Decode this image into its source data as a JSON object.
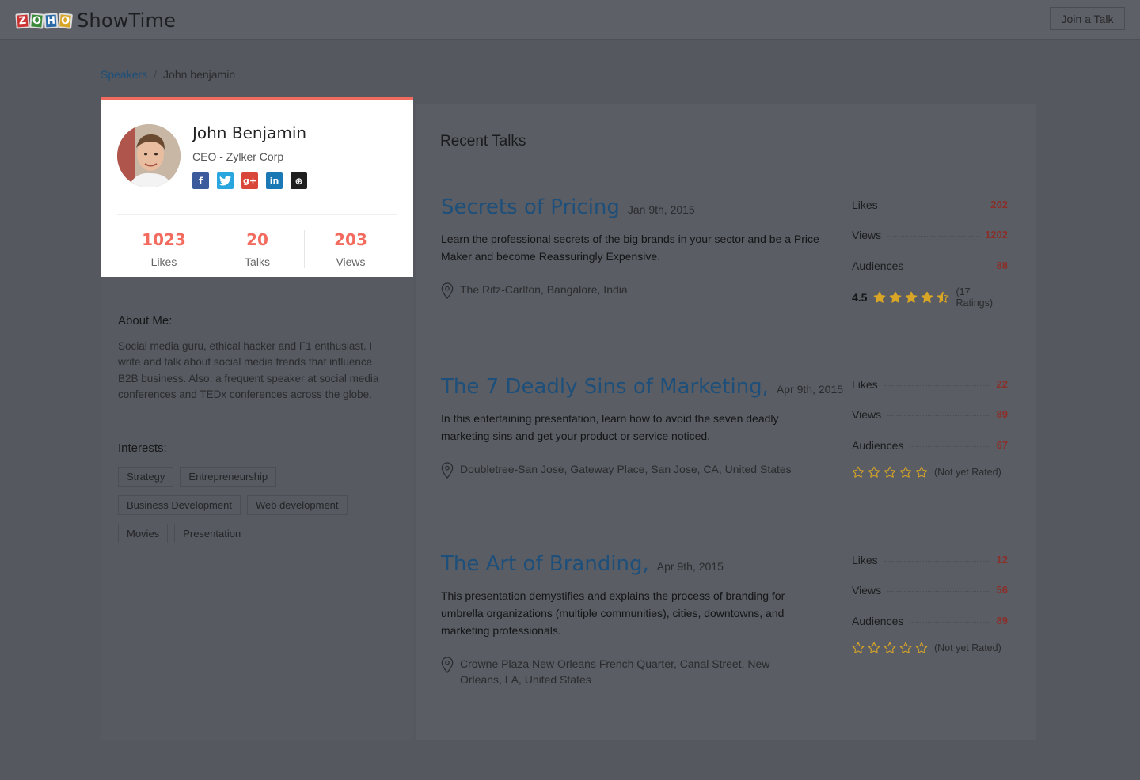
{
  "app": {
    "logo_letters": [
      "Z",
      "O",
      "H",
      "O"
    ],
    "logo_text": "ShowTime",
    "join_button": "Join a Talk"
  },
  "breadcrumb": {
    "parent": "Speakers",
    "separator": "/",
    "current": "John benjamin"
  },
  "profile": {
    "name": "John Benjamin",
    "title": "CEO - Zylker Corp",
    "socials": [
      {
        "icon": "facebook-icon",
        "glyph": "f"
      },
      {
        "icon": "twitter-icon",
        "glyph": "t"
      },
      {
        "icon": "google-plus-icon",
        "glyph": "g+"
      },
      {
        "icon": "linkedin-icon",
        "glyph": "in"
      },
      {
        "icon": "website-icon",
        "glyph": "⊕"
      }
    ],
    "stats": [
      {
        "value": "1023",
        "label": "Likes"
      },
      {
        "value": "20",
        "label": "Talks"
      },
      {
        "value": "203",
        "label": "Views"
      }
    ]
  },
  "about": {
    "heading": "About Me:",
    "text": "Social media guru, ethical hacker and F1 enthusiast. I write and talk about social media trends that influence B2B business. Also, a frequent speaker at social media conferences and TEDx conferences across the globe."
  },
  "interests": {
    "heading": "Interests:",
    "tags": [
      "Strategy",
      "Entrepreneurship",
      "Business Development",
      "Web development",
      "Movies",
      "Presentation"
    ]
  },
  "recent_talks": {
    "heading": "Recent Talks",
    "talks": [
      {
        "title": "Secrets of Pricing",
        "date": "Jan 9th, 2015",
        "description": "Learn the professional secrets of the big brands in your sector and be a Price Maker and become Reassuringly Expensive.",
        "location": "The Ritz-Carlton, Bangalore, India",
        "likes_label": "Likes",
        "likes": "202",
        "views_label": "Views",
        "views": "1202",
        "audiences_label": "Audiences",
        "audiences": "88",
        "rating": "4.5",
        "rating_value": 4.5,
        "rating_text": "(17 Ratings)"
      },
      {
        "title": "The 7 Deadly Sins of Marketing,",
        "date": "Apr 9th, 2015",
        "description": "In this entertaining presentation, learn how to avoid the seven deadly marketing sins and get your product or service noticed.",
        "location": "Doubletree-San Jose, Gateway Place, San Jose, CA, United States",
        "likes_label": "Likes",
        "likes": "22",
        "views_label": "Views",
        "views": "89",
        "audiences_label": "Audiences",
        "audiences": "67",
        "rating": "",
        "rating_value": 0,
        "rating_text": "(Not yet Rated)"
      },
      {
        "title": "The Art of Branding,",
        "date": "Apr 9th, 2015",
        "description": "This presentation demystifies and explains the process of branding for umbrella organizations (multiple communities), cities, downtowns, and marketing professionals.",
        "location": "Crowne Plaza New Orleans French Quarter, Canal Street, New Orleans, LA, United States",
        "likes_label": "Likes",
        "likes": "12",
        "views_label": "Views",
        "views": "56",
        "audiences_label": "Audiences",
        "audiences": "89",
        "rating": "",
        "rating_value": 0,
        "rating_text": "(Not yet Rated)"
      }
    ]
  },
  "colors": {
    "accent": "#f26b5e",
    "link": "#1d4f7a",
    "star": "#d8a527",
    "overlay_bg": "#55585e"
  }
}
